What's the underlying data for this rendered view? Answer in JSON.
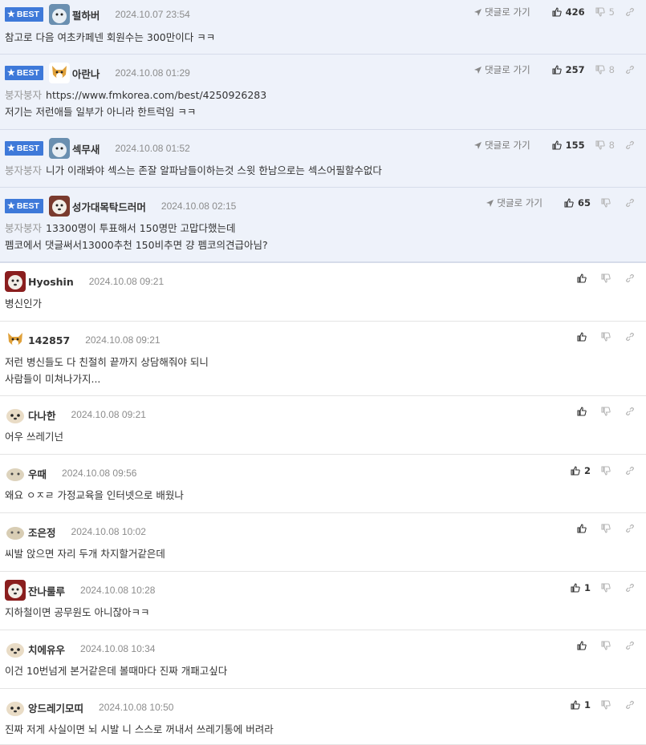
{
  "labels": {
    "best": "BEST",
    "goto": "댓글로 가기"
  },
  "best_comments": [
    {
      "user": "펄하버",
      "date": "2024.10.07 23:54",
      "up": "426",
      "down": "5",
      "lines": [
        "참고로 다음 여초카페넨 회원수는 300만이다 ㅋㅋ"
      ]
    },
    {
      "user": "아란나",
      "date": "2024.10.08 01:29",
      "up": "257",
      "down": "8",
      "target": "붕자붕자",
      "link": "https://www.fmkorea.com/best/4250926283",
      "lines": [
        "저기는 저런애들 일부가 아니라 한트럭임 ㅋㅋ"
      ]
    },
    {
      "user": "섹무새",
      "date": "2024.10.08 01:52",
      "up": "155",
      "down": "8",
      "target": "붕자붕자",
      "lines": [
        "니가 이래봐야 섹스는 존잘 알파남들이하는것 스윗 한남으로는 섹스어필할수없다"
      ]
    },
    {
      "user": "성가대목탁드러머",
      "date": "2024.10.08 02:15",
      "up": "65",
      "down": "",
      "target": "붕자붕자",
      "lines": [
        "13300명이 투표해서 150명만 고맙다했는데",
        "펨코에서 댓글써서13000추천 150비추면 걍 펨코의견급아님?"
      ]
    }
  ],
  "comments": [
    {
      "user": "Hyoshin",
      "date": "2024.10.08 09:21",
      "up": "",
      "lines": [
        "병신인가"
      ]
    },
    {
      "user": "142857",
      "date": "2024.10.08 09:21",
      "up": "",
      "lines": [
        "저런 병신들도 다 친절히 끝까지 상담해줘야 되니",
        "사람들이 미쳐나가지..."
      ]
    },
    {
      "user": "다나한",
      "date": "2024.10.08 09:21",
      "up": "",
      "lines": [
        "어우 쓰레기넌"
      ]
    },
    {
      "user": "우때",
      "date": "2024.10.08 09:56",
      "up": "2",
      "lines": [
        "왜요 ㅇㅈㄹ 가정교육을 인터넷으로 배웠나"
      ]
    },
    {
      "user": "조은정",
      "date": "2024.10.08 10:02",
      "up": "",
      "lines": [
        "씨발 앉으면 자리 두개 차지할거같은데"
      ]
    },
    {
      "user": "잔나룰루",
      "date": "2024.10.08 10:28",
      "up": "1",
      "lines": [
        "지하철이면 공무원도 아니잖아ㅋㅋ"
      ]
    },
    {
      "user": "치에유우",
      "date": "2024.10.08 10:34",
      "up": "",
      "lines": [
        "이건 10번넘게 본거같은데 볼때마다 진짜 개패고싶다"
      ]
    },
    {
      "user": "앙드레기모띠",
      "date": "2024.10.08 10:50",
      "up": "1",
      "lines": [
        "진짜 저게 사실이면 뇌 시발 니 스스로 꺼내서 쓰레기통에 버려라"
      ]
    }
  ]
}
